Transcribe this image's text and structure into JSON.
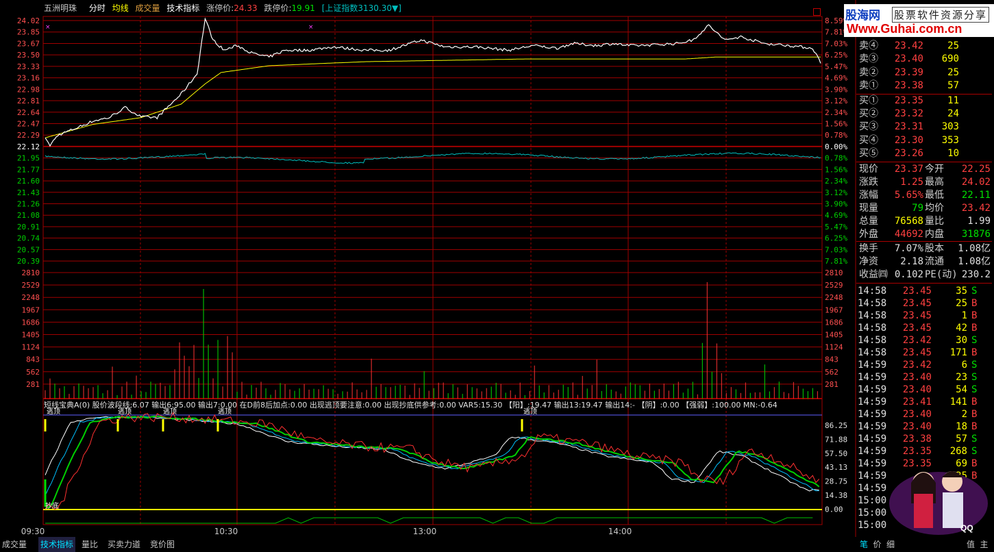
{
  "header": {
    "stock_name": "五洲明珠",
    "tab_time": "分时",
    "tab_avg": "均线",
    "tab_vol": "成交量",
    "tab_tech": "技术指标",
    "limit_up_label": "涨停价:",
    "limit_up": "24.33",
    "limit_down_label": "跌停价:",
    "limit_down": "19.91",
    "index_label": "[上证指数",
    "index_value": "3130.30▼]"
  },
  "logo": {
    "brand": "股海网",
    "slogan": "股票软件资源分享",
    "url": "Www.Guhai.com.cn"
  },
  "price_axis": [
    "24.02",
    "23.85",
    "23.67",
    "23.50",
    "23.33",
    "23.16",
    "22.98",
    "22.81",
    "22.64",
    "22.47",
    "22.29",
    "22.12",
    "21.95",
    "21.77",
    "21.60",
    "21.43",
    "21.26",
    "21.08",
    "20.91",
    "20.74",
    "20.57",
    "20.39"
  ],
  "pct_axis": [
    "8.59%",
    "7.81%",
    "7.03%",
    "6.25%",
    "5.47%",
    "4.69%",
    "3.90%",
    "3.12%",
    "2.34%",
    "1.56%",
    "0.78%",
    "0.00%",
    "0.78%",
    "1.56%",
    "2.34%",
    "3.12%",
    "3.90%",
    "4.69%",
    "5.47%",
    "6.25%",
    "7.03%",
    "7.81%"
  ],
  "vol_axis": [
    "2810",
    "2529",
    "2248",
    "1967",
    "1686",
    "1405",
    "1124",
    "843",
    "562",
    "281"
  ],
  "ind_axis": [
    "86.25",
    "71.88",
    "57.50",
    "43.13",
    "28.75",
    "14.38",
    "0.00"
  ],
  "time_axis": [
    "09:30",
    "10:30",
    "13:00",
    "14:00"
  ],
  "indicator": {
    "text": "短线宝典A(0)  股价波段线:6.07  输出6:95.00  输出7:0.00  在D前8后加点:0.00  出现逃顶要注意:0.00  出现抄底供参考:0.00  VAR5:15.30  【阳】:19.47  输出13:19.47  输出14:-  【阴】:0.00  【强弱】:100.00  MN:-0.64",
    "mark_top": "逃顶",
    "mark_bottom": "抄底"
  },
  "order_book": [
    {
      "label": "卖④",
      "price": "23.42",
      "vol": "25"
    },
    {
      "label": "卖③",
      "price": "23.40",
      "vol": "690"
    },
    {
      "label": "卖②",
      "price": "23.39",
      "vol": "25"
    },
    {
      "label": "卖①",
      "price": "23.38",
      "vol": "57"
    },
    {
      "label": "买①",
      "price": "23.35",
      "vol": "11"
    },
    {
      "label": "买②",
      "price": "23.32",
      "vol": "24"
    },
    {
      "label": "买③",
      "price": "23.31",
      "vol": "303"
    },
    {
      "label": "买④",
      "price": "23.30",
      "vol": "353"
    },
    {
      "label": "买⑤",
      "price": "23.26",
      "vol": "10"
    }
  ],
  "quote": [
    {
      "l1": "现价",
      "v1": "23.37",
      "l2": "今开",
      "v2": "22.25"
    },
    {
      "l1": "涨跌",
      "v1": "1.25",
      "l2": "最高",
      "v2": "24.02"
    },
    {
      "l1": "涨幅",
      "v1": "5.65%",
      "l2": "最低",
      "v2": "22.11"
    },
    {
      "l1": "现量",
      "v1": "79",
      "l2": "均价",
      "v2": "23.42"
    },
    {
      "l1": "总量",
      "v1": "76568",
      "l2": "量比",
      "v2": "1.99"
    },
    {
      "l1": "外盘",
      "v1": "44692",
      "l2": "内盘",
      "v2": "31876"
    },
    {
      "l1": "换手",
      "v1": "7.07%",
      "l2": "股本",
      "v2": "1.08亿"
    },
    {
      "l1": "净资",
      "v1": "2.18",
      "l2": "流通",
      "v2": "1.08亿"
    },
    {
      "l1": "收益㈣",
      "v1": "0.102",
      "l2": "PE(动)",
      "v2": "230.2"
    }
  ],
  "ticks": [
    {
      "t": "14:58",
      "p": "23.45",
      "v": "35",
      "s": "S"
    },
    {
      "t": "14:58",
      "p": "23.45",
      "v": "25",
      "s": "B"
    },
    {
      "t": "14:58",
      "p": "23.45",
      "v": "1",
      "s": "B"
    },
    {
      "t": "14:58",
      "p": "23.45",
      "v": "42",
      "s": "B"
    },
    {
      "t": "14:58",
      "p": "23.42",
      "v": "30",
      "s": "S"
    },
    {
      "t": "14:58",
      "p": "23.45",
      "v": "171",
      "s": "B"
    },
    {
      "t": "14:59",
      "p": "23.42",
      "v": "6",
      "s": "S"
    },
    {
      "t": "14:59",
      "p": "23.40",
      "v": "23",
      "s": "S"
    },
    {
      "t": "14:59",
      "p": "23.40",
      "v": "54",
      "s": "S"
    },
    {
      "t": "14:59",
      "p": "23.41",
      "v": "141",
      "s": "B"
    },
    {
      "t": "14:59",
      "p": "23.40",
      "v": "2",
      "s": "B"
    },
    {
      "t": "14:59",
      "p": "23.40",
      "v": "18",
      "s": "B"
    },
    {
      "t": "14:59",
      "p": "23.38",
      "v": "57",
      "s": "S"
    },
    {
      "t": "14:59",
      "p": "23.35",
      "v": "268",
      "s": "S"
    },
    {
      "t": "14:59",
      "p": "23.35",
      "v": "69",
      "s": "B"
    },
    {
      "t": "14:59",
      "p": "",
      "v": "25",
      "s": "B"
    },
    {
      "t": "14:59",
      "p": "",
      "v": "21",
      "s": "B"
    },
    {
      "t": "15:00",
      "p": "",
      "v": "",
      "s": ""
    },
    {
      "t": "15:00",
      "p": "",
      "v": "",
      "s": ""
    },
    {
      "t": "15:00",
      "p": "",
      "v": "",
      "s": ""
    }
  ],
  "bottom_tabs": [
    "成交量",
    "技术指标",
    "量比",
    "买卖力道",
    "竞价图"
  ],
  "side_tabs": [
    "笔",
    "价",
    "细",
    "",
    "",
    "",
    "",
    "",
    "值",
    "主"
  ],
  "colors": {
    "up": "#ff3232",
    "down": "#00e000",
    "price_line": "#ffffff",
    "avg_line": "#ffff00",
    "grid": "#a00000",
    "label_up": "#ff5050",
    "label_green": "#00d000",
    "yellow": "#ffff00",
    "cyan": "#00c0c0"
  }
}
